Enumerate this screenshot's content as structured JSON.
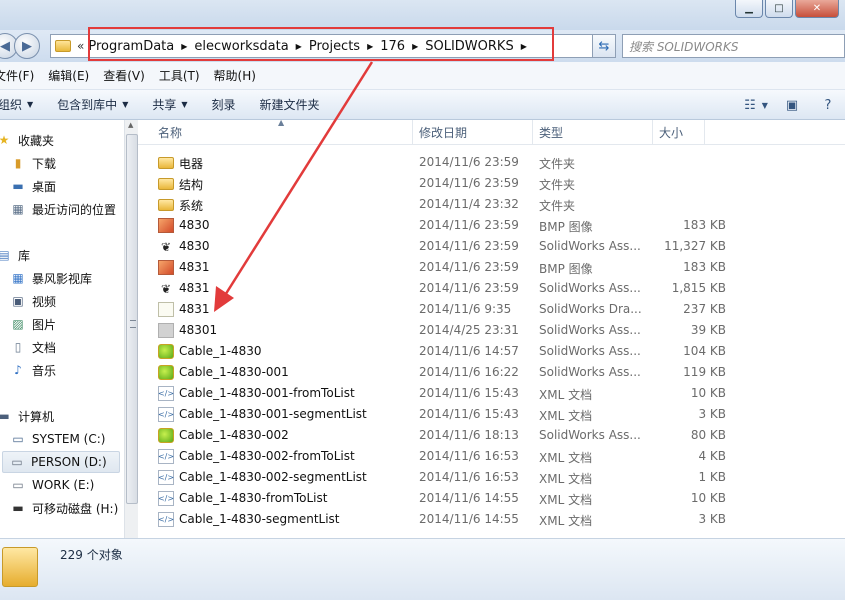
{
  "window": {
    "minimize_label": "▁",
    "maximize_label": "□",
    "close_label": "✕"
  },
  "address": {
    "overflow_label": "«",
    "crumbs": [
      "ProgramData",
      "elecworksdata",
      "Projects",
      "176",
      "SOLIDWORKS"
    ],
    "search_placeholder": "搜索 SOLIDWORKS"
  },
  "menu": [
    "文件(F)",
    "编辑(E)",
    "查看(V)",
    "工具(T)",
    "帮助(H)"
  ],
  "toolbar": {
    "organize": "组织",
    "include_library": "包含到库中",
    "share": "共享",
    "burn": "刻录",
    "new_folder": "新建文件夹"
  },
  "nav": {
    "favorites": "收藏夹",
    "downloads": "下载",
    "desktop": "桌面",
    "recent": "最近访问的位置",
    "libraries": "库",
    "storm": "暴风影视库",
    "videos": "视频",
    "pictures": "图片",
    "documents": "文档",
    "music": "音乐",
    "computer": "计算机",
    "drive_c": "SYSTEM (C:)",
    "drive_d": "PERSON (D:)",
    "drive_e": "WORK (E:)",
    "drive_h": "可移动磁盘 (H:)"
  },
  "columns": {
    "name": "名称",
    "date": "修改日期",
    "type": "类型",
    "size": "大小"
  },
  "files": [
    {
      "icon": "folder",
      "name": "电器",
      "date": "2014/11/6 23:59",
      "type": "文件夹",
      "size": ""
    },
    {
      "icon": "folder",
      "name": "结构",
      "date": "2014/11/6 23:59",
      "type": "文件夹",
      "size": ""
    },
    {
      "icon": "folder",
      "name": "系统",
      "date": "2014/11/4 23:32",
      "type": "文件夹",
      "size": ""
    },
    {
      "icon": "bmp",
      "name": "4830",
      "date": "2014/11/6 23:59",
      "type": "BMP 图像",
      "size": "183 KB"
    },
    {
      "icon": "sldasm",
      "name": "4830",
      "date": "2014/11/6 23:59",
      "type": "SolidWorks Ass...",
      "size": "11,327 KB"
    },
    {
      "icon": "bmp",
      "name": "4831",
      "date": "2014/11/6 23:59",
      "type": "BMP 图像",
      "size": "183 KB"
    },
    {
      "icon": "sldasm",
      "name": "4831",
      "date": "2014/11/6 23:59",
      "type": "SolidWorks Ass...",
      "size": "1,815 KB"
    },
    {
      "icon": "drw",
      "name": "4831",
      "date": "2014/11/6 9:35",
      "type": "SolidWorks Dra...",
      "size": "237 KB"
    },
    {
      "icon": "gray",
      "name": "48301",
      "date": "2014/4/25 23:31",
      "type": "SolidWorks Ass...",
      "size": "39 KB"
    },
    {
      "icon": "cable",
      "name": "Cable_1-4830",
      "date": "2014/11/6 14:57",
      "type": "SolidWorks Ass...",
      "size": "104 KB"
    },
    {
      "icon": "cable",
      "name": "Cable_1-4830-001",
      "date": "2014/11/6 16:22",
      "type": "SolidWorks Ass...",
      "size": "119 KB"
    },
    {
      "icon": "xml",
      "name": "Cable_1-4830-001-fromToList",
      "date": "2014/11/6 15:43",
      "type": "XML 文档",
      "size": "10 KB"
    },
    {
      "icon": "xml",
      "name": "Cable_1-4830-001-segmentList",
      "date": "2014/11/6 15:43",
      "type": "XML 文档",
      "size": "3 KB"
    },
    {
      "icon": "cable",
      "name": "Cable_1-4830-002",
      "date": "2014/11/6 18:13",
      "type": "SolidWorks Ass...",
      "size": "80 KB"
    },
    {
      "icon": "xml",
      "name": "Cable_1-4830-002-fromToList",
      "date": "2014/11/6 16:53",
      "type": "XML 文档",
      "size": "4 KB"
    },
    {
      "icon": "xml",
      "name": "Cable_1-4830-002-segmentList",
      "date": "2014/11/6 16:53",
      "type": "XML 文档",
      "size": "1 KB"
    },
    {
      "icon": "xml",
      "name": "Cable_1-4830-fromToList",
      "date": "2014/11/6 14:55",
      "type": "XML 文档",
      "size": "10 KB"
    },
    {
      "icon": "xml",
      "name": "Cable_1-4830-segmentList",
      "date": "2014/11/6 14:55",
      "type": "XML 文档",
      "size": "3 KB"
    }
  ],
  "status": {
    "count": "229 个对象"
  },
  "annotation": {
    "color": "#e23b3b"
  }
}
